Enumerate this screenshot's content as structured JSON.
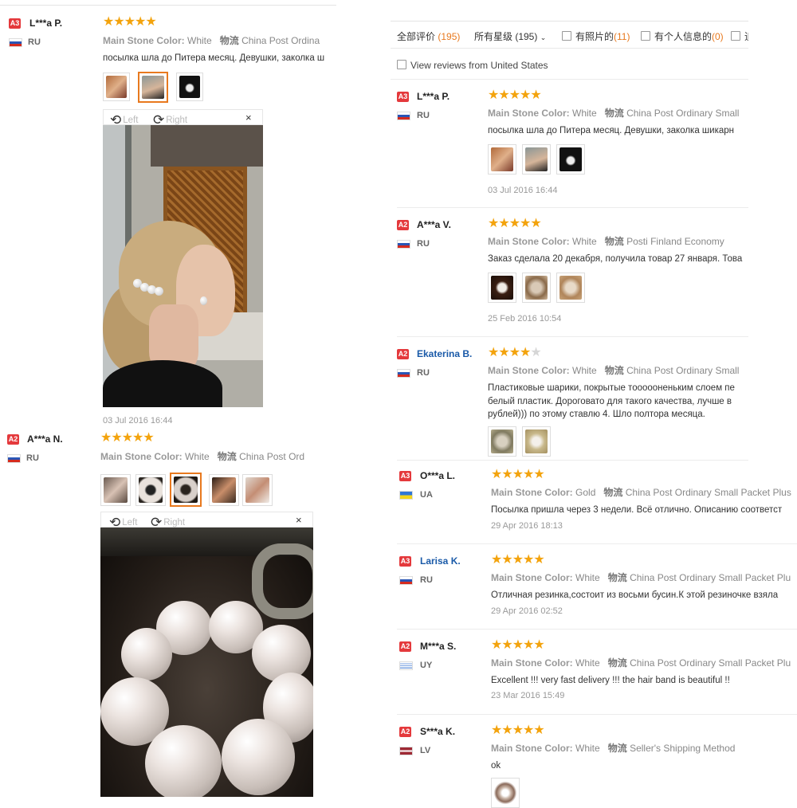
{
  "left_col": {
    "review1": {
      "badge": "A3",
      "name": "L***a P.",
      "country": "RU",
      "rating": 5,
      "attr_label": "Main Stone Color:",
      "attr_value": "White",
      "ship_label": "物流",
      "ship_value": "China Post Ordina",
      "text": "посылка шла до Питера месяц. Девушки, заколка ш",
      "viewer": {
        "left": "Left",
        "right": "Right",
        "close": "×"
      },
      "date": "03 Jul 2016 16:44"
    },
    "review2": {
      "badge": "A2",
      "name": "A***a N.",
      "country": "RU",
      "rating": 5,
      "attr_label": "Main Stone Color:",
      "attr_value": "White",
      "ship_label": "物流",
      "ship_value": "China Post Ord",
      "viewer": {
        "left": "Left",
        "right": "Right",
        "close": "×"
      }
    }
  },
  "filters": {
    "all_label": "全部评价",
    "all_count": "(195)",
    "stars_label": "所有星级 (195)",
    "photos_label": "有照片的",
    "photos_count": "(11)",
    "personal_label": "有个人信息的",
    "personal_count": "(0)",
    "more_label": "追",
    "us_label": "View reviews from United States"
  },
  "reviews": [
    {
      "badge": "A3",
      "name": "L***a P.",
      "country": "RU",
      "flag": "ru",
      "rating": 5,
      "link": false,
      "attr_label": "Main Stone Color:",
      "attr_value": "White",
      "ship_label": "物流",
      "ship_value": "China Post Ordinary Small",
      "text": [
        "посылка шла до Питера месяц. Девушки, заколка шикарн"
      ],
      "date": "03 Jul 2016 16:44"
    },
    {
      "badge": "A2",
      "name": "A***a V.",
      "country": "RU",
      "flag": "ru",
      "rating": 5,
      "link": false,
      "attr_label": "Main Stone Color:",
      "attr_value": "White",
      "ship_label": "物流",
      "ship_value": "Posti Finland Economy",
      "text": [
        "Заказ сделала 20 декабря, получила товар 27 января. Това"
      ],
      "date": "25 Feb 2016 10:54"
    },
    {
      "badge": "A2",
      "name": "Ekaterina B.",
      "country": "RU",
      "flag": "ru",
      "rating": 4,
      "link": true,
      "attr_label": "Main Stone Color:",
      "attr_value": "White",
      "ship_label": "物流",
      "ship_value": "China Post Ordinary Small",
      "text": [
        "Пластиковые шарики, покрытые тоооооненьким слоем пе",
        "белый пластик. Дороговато для такого качества, лучше в",
        "рублей))) по этому ставлю 4. Шло полтора месяца."
      ],
      "date": ""
    },
    {
      "badge": "A3",
      "name": "O***a L.",
      "country": "UA",
      "flag": "ua",
      "rating": 5,
      "link": false,
      "attr_label": "Main Stone Color:",
      "attr_value": "Gold",
      "ship_label": "物流",
      "ship_value": "China Post Ordinary Small Packet Plus",
      "text": [
        "Посылка пришла через 3 недели. Всё отлично. Описанию соответст"
      ],
      "date": "29 Apr 2016 18:13"
    },
    {
      "badge": "A3",
      "name": "Larisa K.",
      "country": "RU",
      "flag": "ru",
      "rating": 5,
      "link": true,
      "attr_label": "Main Stone Color:",
      "attr_value": "White",
      "ship_label": "物流",
      "ship_value": "China Post Ordinary Small Packet Plu",
      "text": [
        "Отличная резинка,состоит из восьми бусин.К этой резиночке взяла"
      ],
      "date": "29 Apr 2016 02:52"
    },
    {
      "badge": "A2",
      "name": "M***a S.",
      "country": "UY",
      "flag": "uy",
      "rating": 5,
      "link": false,
      "attr_label": "Main Stone Color:",
      "attr_value": "White",
      "ship_label": "物流",
      "ship_value": "China Post Ordinary Small Packet Plu",
      "text": [
        "Excellent !!! very fast delivery !!! the hair band is beautiful !!"
      ],
      "date": "23 Mar 2016 15:49"
    },
    {
      "badge": "A2",
      "name": "S***a K.",
      "country": "LV",
      "flag": "lv",
      "rating": 5,
      "link": false,
      "attr_label": "Main Stone Color:",
      "attr_value": "White",
      "ship_label": "物流",
      "ship_value": "Seller's Shipping Method",
      "text": [
        "ok"
      ],
      "date": ""
    }
  ],
  "colors": {
    "accent": "#e8791e",
    "badge": "#e4393c",
    "star": "#f3a30d",
    "link": "#1a5aa8"
  }
}
